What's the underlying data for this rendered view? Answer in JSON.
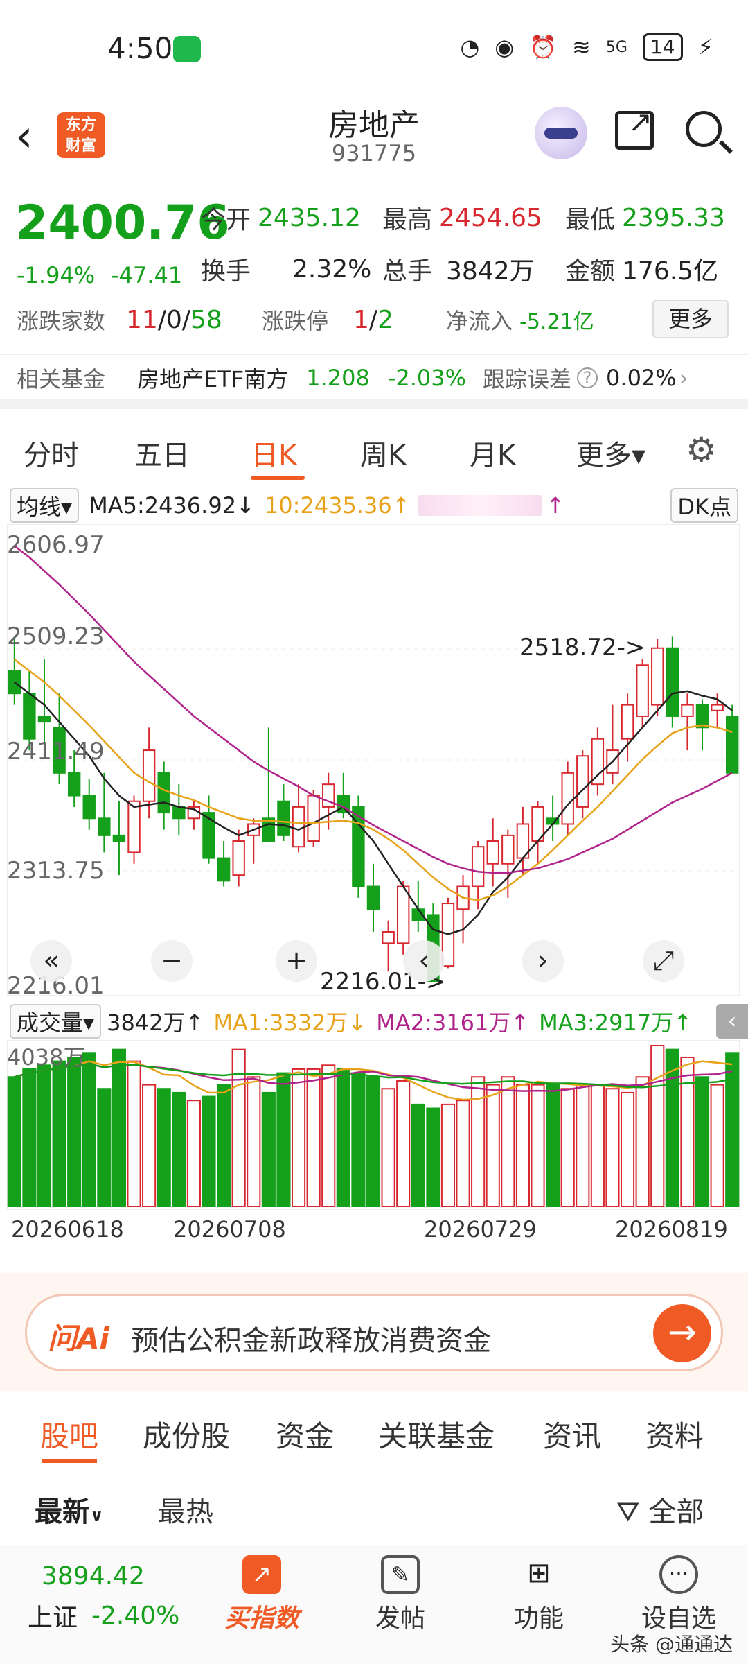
{
  "status": {
    "time": "4:50",
    "network": "5G",
    "battery": "14"
  },
  "header": {
    "title": "房地产",
    "code": "931775",
    "logo_text": "东方\n财富"
  },
  "quote": {
    "price": "2400.76",
    "change_pct": "-1.94%",
    "change_abs": "-47.41",
    "open_label": "今开",
    "open": "2435.12",
    "high_label": "最高",
    "high": "2454.65",
    "low_label": "最低",
    "low": "2395.33",
    "turnover_label": "换手",
    "turnover": "2.32%",
    "volume_label": "总手",
    "volume": "3842万",
    "amount_label": "金额",
    "amount": "176.5亿",
    "adv_label": "涨跌家数",
    "adv_up": "11",
    "adv_flat": "0",
    "adv_down": "58",
    "limit_label": "涨跌停",
    "limit_up": "1",
    "limit_down": "2",
    "netflow_label": "净流入",
    "netflow": "-5.21亿",
    "more_label": "更多"
  },
  "fund": {
    "label": "相关基金",
    "name": "房地产ETF南方",
    "price": "1.208",
    "pct": "-2.03%",
    "err_label": "跟踪误差",
    "err": "0.02%"
  },
  "chart_tabs": [
    "分时",
    "五日",
    "日K",
    "周K",
    "月K",
    "更多▾"
  ],
  "ma_legend": {
    "selector": "均线▾",
    "ma5": "MA5:2436.92↓",
    "ma10": "10:2435.36↑",
    "tail": "↑",
    "dk": "DK点"
  },
  "chart_data": {
    "type": "candlestick",
    "y_ticks": [
      "2606.97",
      "2509.23",
      "2411.49",
      "2313.75",
      "2216.01"
    ],
    "ylim": [
      2216.01,
      2606.97
    ],
    "annotations": {
      "high": "2518.72->",
      "low": "2216.01->"
    },
    "candles": [
      [
        2490,
        2520,
        2460,
        2470
      ],
      [
        2470,
        2490,
        2420,
        2430
      ],
      [
        2450,
        2500,
        2420,
        2445
      ],
      [
        2440,
        2470,
        2390,
        2400
      ],
      [
        2400,
        2420,
        2370,
        2380
      ],
      [
        2380,
        2395,
        2350,
        2360
      ],
      [
        2360,
        2400,
        2330,
        2345
      ],
      [
        2345,
        2375,
        2310,
        2340
      ],
      [
        2330,
        2380,
        2320,
        2375
      ],
      [
        2375,
        2440,
        2360,
        2420
      ],
      [
        2400,
        2410,
        2350,
        2365
      ],
      [
        2370,
        2390,
        2345,
        2360
      ],
      [
        2360,
        2375,
        2350,
        2370
      ],
      [
        2365,
        2380,
        2320,
        2325
      ],
      [
        2325,
        2340,
        2300,
        2305
      ],
      [
        2310,
        2350,
        2300,
        2340
      ],
      [
        2345,
        2360,
        2320,
        2355
      ],
      [
        2360,
        2440,
        2350,
        2340
      ],
      [
        2375,
        2390,
        2340,
        2345
      ],
      [
        2335,
        2390,
        2330,
        2370
      ],
      [
        2340,
        2385,
        2335,
        2380
      ],
      [
        2370,
        2400,
        2350,
        2390
      ],
      [
        2380,
        2400,
        2360,
        2365
      ],
      [
        2370,
        2380,
        2290,
        2300
      ],
      [
        2300,
        2320,
        2260,
        2280
      ],
      [
        2250,
        2270,
        2225,
        2260
      ],
      [
        2250,
        2305,
        2240,
        2300
      ],
      [
        2280,
        2305,
        2260,
        2270
      ],
      [
        2275,
        2285,
        2216,
        2216
      ],
      [
        2230,
        2290,
        2228,
        2285
      ],
      [
        2280,
        2310,
        2250,
        2300
      ],
      [
        2300,
        2340,
        2280,
        2335
      ],
      [
        2320,
        2360,
        2300,
        2340
      ],
      [
        2320,
        2350,
        2290,
        2345
      ],
      [
        2325,
        2370,
        2310,
        2355
      ],
      [
        2340,
        2375,
        2320,
        2370
      ],
      [
        2360,
        2380,
        2340,
        2355
      ],
      [
        2355,
        2410,
        2345,
        2400
      ],
      [
        2370,
        2420,
        2360,
        2415
      ],
      [
        2390,
        2440,
        2380,
        2430
      ],
      [
        2400,
        2460,
        2390,
        2420
      ],
      [
        2430,
        2470,
        2410,
        2460
      ],
      [
        2450,
        2500,
        2440,
        2495
      ],
      [
        2460,
        2518,
        2450,
        2510
      ],
      [
        2510,
        2520,
        2440,
        2450
      ],
      [
        2450,
        2470,
        2420,
        2460
      ],
      [
        2460,
        2465,
        2420,
        2440
      ],
      [
        2455,
        2470,
        2440,
        2460
      ],
      [
        2450,
        2460,
        2400,
        2400
      ]
    ],
    "ma_series": [
      {
        "name": "MA5",
        "color": "#222222",
        "values": [
          2480,
          2470,
          2460,
          2445,
          2430,
          2415,
          2395,
          2380,
          2370,
          2372,
          2374,
          2370,
          2368,
          2360,
          2352,
          2345,
          2350,
          2355,
          2354,
          2350,
          2356,
          2363,
          2370,
          2355,
          2340,
          2320,
          2300,
          2280,
          2262,
          2258,
          2262,
          2275,
          2295,
          2308,
          2325,
          2340,
          2355,
          2372,
          2385,
          2398,
          2410,
          2425,
          2440,
          2455,
          2470,
          2472,
          2468,
          2465,
          2455
        ]
      },
      {
        "name": "MA10",
        "color": "#e8a21a",
        "values": [
          2500,
          2490,
          2480,
          2468,
          2455,
          2442,
          2428,
          2414,
          2400,
          2392,
          2385,
          2380,
          2376,
          2370,
          2365,
          2360,
          2358,
          2358,
          2357,
          2356,
          2356,
          2357,
          2358,
          2356,
          2350,
          2342,
          2332,
          2320,
          2308,
          2298,
          2290,
          2288,
          2292,
          2300,
          2310,
          2320,
          2332,
          2345,
          2358,
          2370,
          2384,
          2398,
          2412,
          2424,
          2435,
          2440,
          2442,
          2440,
          2436
        ]
      },
      {
        "name": "MA20",
        "color": "#b0238a",
        "values": [
          2600,
          2590,
          2578,
          2566,
          2553,
          2540,
          2526,
          2512,
          2498,
          2486,
          2474,
          2462,
          2450,
          2440,
          2430,
          2420,
          2410,
          2402,
          2395,
          2388,
          2380,
          2375,
          2370,
          2362,
          2354,
          2347,
          2340,
          2333,
          2326,
          2320,
          2316,
          2313,
          2312,
          2312,
          2314,
          2316,
          2320,
          2324,
          2330,
          2336,
          2342,
          2350,
          2358,
          2366,
          2374,
          2380,
          2386,
          2393,
          2400
        ]
      }
    ],
    "volume": {
      "y_tick": "4038万",
      "values": [
        3300,
        3500,
        3600,
        3700,
        3800,
        3900,
        3000,
        4000,
        3700,
        3100,
        3000,
        2900,
        2700,
        2800,
        3100,
        4000,
        3300,
        2900,
        3400,
        3500,
        3500,
        3600,
        3500,
        3400,
        3300,
        3000,
        3200,
        2600,
        2500,
        2600,
        2700,
        3300,
        3100,
        3300,
        3100,
        3100,
        3100,
        3000,
        3100,
        3100,
        3000,
        2900,
        3300,
        4100,
        4000,
        3800,
        3300,
        3100,
        3900
      ],
      "ma_series": [
        {
          "name": "MA1",
          "label": "MA1:3332万↓",
          "color": "#e8a21a"
        },
        {
          "name": "MA2",
          "label": "MA2:3161万↑",
          "color": "#b0238a"
        },
        {
          "name": "MA3",
          "label": "MA3:2917万↑",
          "color": "#14a01a"
        }
      ]
    },
    "dates": [
      "20260618",
      "20260708",
      "20260729",
      "20260819"
    ]
  },
  "vol_legend": {
    "selector": "成交量▾",
    "vol": "3842万↑"
  },
  "ai": {
    "tag": "问Ai",
    "text": "预估公积金新政释放消费资金"
  },
  "post_tabs": [
    "股吧",
    "成份股",
    "资金",
    "关联基金",
    "资讯",
    "资料"
  ],
  "sub_tabs": {
    "latest": "最新",
    "hot": "最热",
    "filter": "全部"
  },
  "bottom_nav": {
    "index_value": "3894.42",
    "index_name": "上证",
    "index_pct": "-2.40%",
    "buy": "买指数",
    "post": "发帖",
    "func": "功能",
    "watch": "设自选"
  },
  "watermark": "头条 @通通达",
  "colors": {
    "up": "#d8282f",
    "down": "#14a01a",
    "accent": "#ef5a25"
  }
}
